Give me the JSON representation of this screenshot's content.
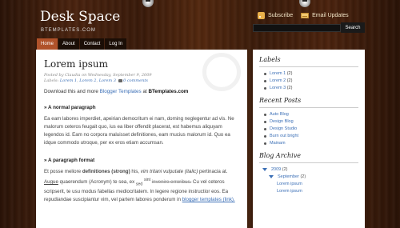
{
  "header": {
    "title": "Desk Space",
    "subtitle": "BTEMPLATES.COM",
    "subscribe_label": "Subscribe",
    "email_label": "Email Updates",
    "search_button": "Search"
  },
  "nav": {
    "tabs": [
      {
        "label": "Home"
      },
      {
        "label": "About"
      },
      {
        "label": "Contact"
      },
      {
        "label": "Log In"
      }
    ]
  },
  "post": {
    "title": "Lorem ipsum",
    "meta_line1": "Posted by Claudia on Wednesday, September 9, 2009",
    "labels_prefix": "Labels:",
    "labels": [
      "Lorem 1",
      "Lorem 2",
      "Lorem 3"
    ],
    "comments": "0 comments",
    "intro_before": "Download this and more",
    "intro_link": "Blogger Templates",
    "intro_middle": "at",
    "intro_bold": "BTemplates.com",
    "section1_title": "» A normal paragraph",
    "section1_text": "Ea eam labores imperdiet, apeirian democritum ei nam, doming neglegentur ad vis. Ne malorum ceteros feugait quo, ius ea liber offendit placerat, est habemus aliquyam legendos id. Eam no corpora maluisset definitiones, eam mucius malorum id. Quo ea idque commodo utroque, per ex eros etiam accumsan.",
    "section2_title": "» A paragraph format",
    "p2_a": "Et posse meliore",
    "p2_bold": "definitiones (strong)",
    "p2_b": "his,",
    "p2_italic": "vim tritani vulputate (italic)",
    "p2_c": "pertinacia at.",
    "p2_u": "Augue",
    "p2_d": "quaerendum (Acronym) te sea, ex",
    "p2_sup": "sed",
    "p2_sup2": "sint",
    "p2_del": "invenire erroribus.",
    "p2_e": "Cu vel ceteros scripserit, te usu modus fabellas mediocritatem. In legere regione instructior eos. Ea repudiandae suscipiantur vim, vel partem labores ponderum in",
    "p2_link": "blogger templates (link)."
  },
  "sidebar": {
    "labels_title": "Labels",
    "labels": [
      {
        "name": "Lorem 1",
        "count": "(2)"
      },
      {
        "name": "Lorem 2",
        "count": "(2)"
      },
      {
        "name": "Lorem 3",
        "count": "(2)"
      }
    ],
    "recent_title": "Recent Posts",
    "recent": [
      "Auto Blog",
      "Design Blog",
      "Design Studio",
      "Burn out bright",
      "Mainam"
    ],
    "archive_title": "Blog Archive",
    "archive_year": "2009",
    "archive_year_count": "(2)",
    "archive_month": "September",
    "archive_month_count": "(2)",
    "archive_posts": [
      "Lorem ipsum",
      "Lorem ipsum"
    ]
  }
}
